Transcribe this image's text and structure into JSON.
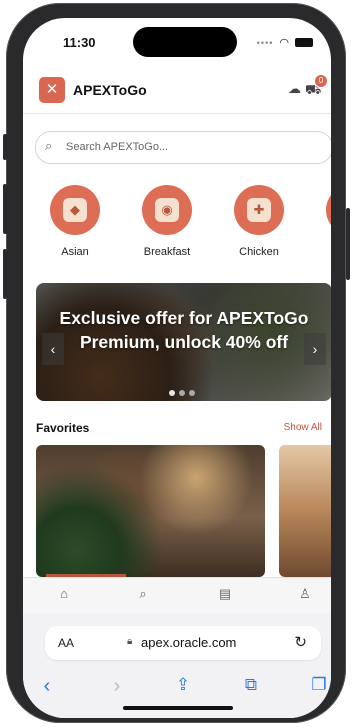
{
  "status": {
    "time": "11:30"
  },
  "app": {
    "title": "APEXToGo",
    "cart_count": "0"
  },
  "search": {
    "placeholder": "Search APEXToGo..."
  },
  "categories": [
    {
      "label": "Asian",
      "icon": "●"
    },
    {
      "label": "Breakfast",
      "icon": "●"
    },
    {
      "label": "Chicken",
      "icon": "●"
    },
    {
      "label": "F",
      "icon": "●"
    }
  ],
  "promo": {
    "text": "Exclusive offer for APEXToGo Premium, unlock 40% off"
  },
  "favorites": {
    "title": "Favorites",
    "show_all": "Show All"
  },
  "browser": {
    "aa": "AA",
    "url": "apex.oracle.com"
  },
  "colors": {
    "accent": "#d9674f",
    "link": "#2a7ae4"
  }
}
